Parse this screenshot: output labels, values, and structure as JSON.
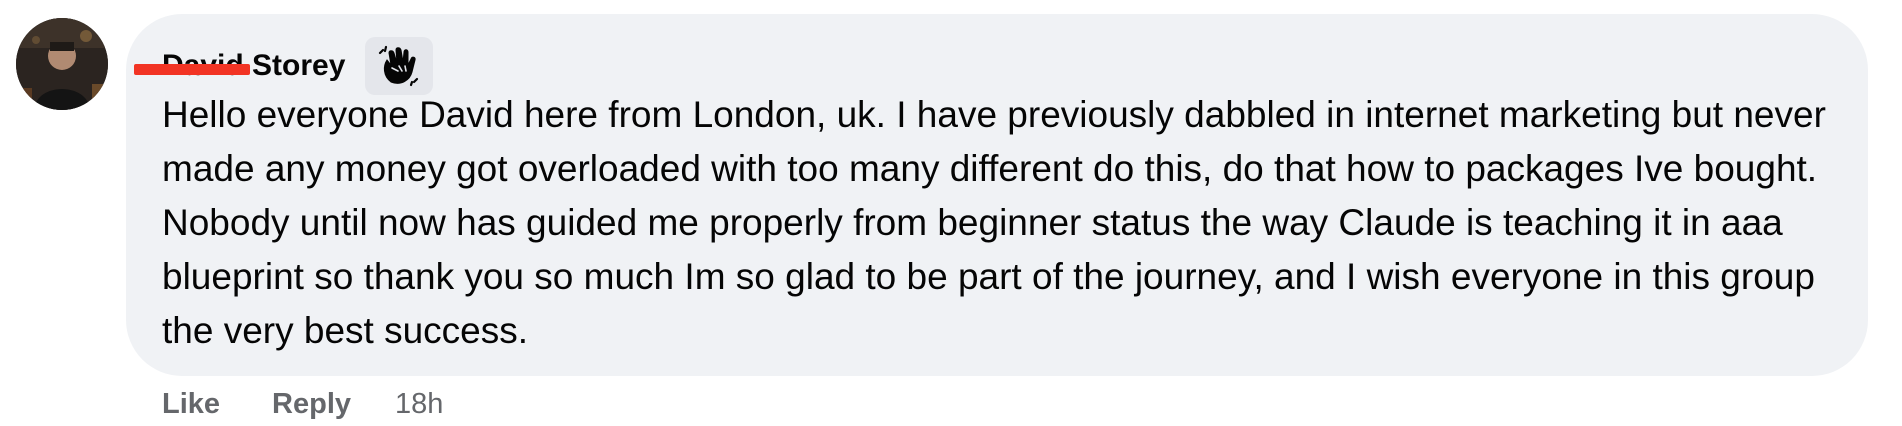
{
  "comment": {
    "author": {
      "name": "David Storey",
      "name_redacted": true,
      "avatar": "avatar-photo",
      "badge_icon": "waving-hand-icon"
    },
    "text": "Hello everyone David here from London, uk. I have previously dabbled in internet marketing but never made any money got overloaded with too many different do this, do that how to packages Ive bought. Nobody until now has guided me properly from beginner status the way Claude is teaching it in aaa blueprint so thank you so much Im so glad to be part of the journey, and I wish everyone in this group the very best success.",
    "actions": {
      "like_label": "Like",
      "reply_label": "Reply",
      "timestamp": "18h"
    }
  },
  "colors": {
    "bubble_background": "#f0f2f5",
    "text_primary": "#050505",
    "text_secondary": "#65676b",
    "badge_background": "#e4e6eb",
    "redaction": "#f23424"
  }
}
